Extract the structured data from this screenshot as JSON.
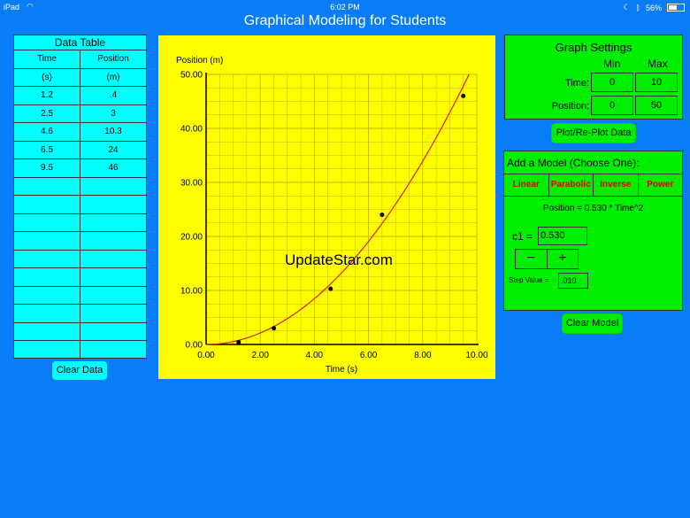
{
  "status": {
    "carrier": "iPad",
    "time": "6:02 PM",
    "battery": "56%",
    "battery_level": 0.56
  },
  "app": {
    "title": "Graphical Modeling for Students"
  },
  "data_table": {
    "title": "Data Table",
    "columns": [
      "Time",
      "Position"
    ],
    "units": [
      "(s)",
      "(m)"
    ],
    "rows": [
      [
        "1.2",
        ".4"
      ],
      [
        "2.5",
        "3"
      ],
      [
        "4.6",
        "10.3"
      ],
      [
        "6.5",
        "24"
      ],
      [
        "9.5",
        "46"
      ]
    ],
    "empty_rows": 10,
    "clear_label": "Clear Data"
  },
  "plot": {
    "ylabel": "Position (m)",
    "xlabel": "Time (s)",
    "watermark": "UpdateStar.com"
  },
  "chart_data": {
    "type": "scatter",
    "xlabel": "Time (s)",
    "ylabel": "Position (m)",
    "xlim": [
      0,
      10
    ],
    "ylim": [
      0,
      50
    ],
    "x_ticks": [
      "0.00",
      "2.00",
      "4.00",
      "6.00",
      "8.00",
      "10.00"
    ],
    "y_ticks": [
      "0.00",
      "10.00",
      "20.00",
      "30.00",
      "40.00",
      "50.00"
    ],
    "grid": true,
    "points": [
      [
        1.2,
        0.4
      ],
      [
        2.5,
        3
      ],
      [
        4.6,
        10.3
      ],
      [
        6.5,
        24
      ],
      [
        9.5,
        46
      ]
    ],
    "model": {
      "form": "parabolic",
      "c1": 0.53,
      "color": "#d81e1e"
    },
    "point_color": "#000000",
    "grid_color": "#c8b400",
    "background": "#ffff00"
  },
  "graph_settings": {
    "title": "Graph Settings",
    "min_label": "Min",
    "max_label": "Max",
    "time_label": "Time:",
    "position_label": "Position:",
    "time_min": "0",
    "time_max": "10",
    "position_min": "0",
    "position_max": "50"
  },
  "plot_button": "Plot/Re-Plot Data",
  "model_panel": {
    "title": "Add a Model (Choose One):",
    "tabs": [
      "Linear",
      "Parabolic",
      "Inverse",
      "Power"
    ],
    "equation": "Position = 0.530 * Time^2",
    "c1_label": "c1 =",
    "c1_value": "0.530",
    "minus": "−",
    "plus": "+",
    "step_label": "Step Value =",
    "step_value": ".010"
  },
  "clear_model": "Clear Model",
  "colors": {
    "background": "#0a7cf5",
    "table": "#00ffff",
    "panel": "#00ee00",
    "plot": "#ffff00",
    "tab_text": "#e00000"
  }
}
